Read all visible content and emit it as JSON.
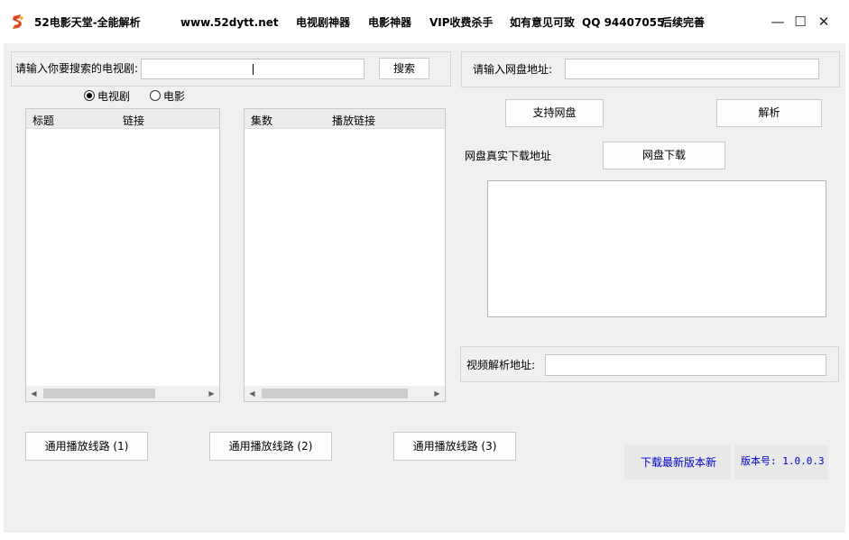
{
  "titlebar": {
    "app_title": "52电影天堂-全能解析",
    "website": "www.52dytt.net",
    "menu": [
      "电视剧神器",
      "电影神器",
      "VIP收费杀手",
      "如有意见可致",
      "QQ 94407055",
      "后续完善"
    ],
    "logo_icon": "s5-logo-icon",
    "minimize_glyph": "—",
    "maximize_glyph": "☐",
    "close_glyph": "✕"
  },
  "search": {
    "label": "请输入你要搜索的电视剧:",
    "value": "",
    "button": "搜索"
  },
  "type_radio": {
    "options": [
      "电视剧",
      "电影"
    ],
    "selected": "电视剧"
  },
  "results_list": {
    "columns": [
      "标题",
      "链接"
    ],
    "rows": []
  },
  "episodes_list": {
    "columns": [
      "集数",
      "播放链接"
    ],
    "rows": []
  },
  "pan": {
    "address_label": "请输入网盘地址:",
    "address_value": "",
    "support_button": "支持网盘",
    "parse_button": "解析",
    "real_label": "网盘真实下载地址",
    "download_button": "网盘下载",
    "output_text": ""
  },
  "video_parse": {
    "label": "视频解析地址:",
    "value": ""
  },
  "play_lines": [
    "通用播放线路 (1)",
    "通用播放线路 (2)",
    "通用播放线路 (3)"
  ],
  "footer": {
    "download_latest": "下载最新版本新",
    "version": "版本号: 1.0.0.3",
    "link_color": "#0000cc"
  }
}
